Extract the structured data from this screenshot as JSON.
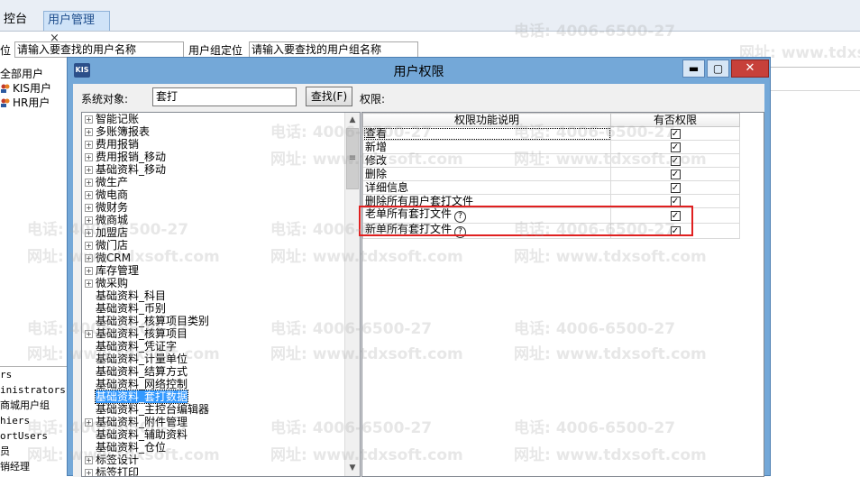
{
  "app": {
    "tabs": [
      {
        "label": "控台"
      },
      {
        "label": "用户管理",
        "close": "×"
      }
    ],
    "filter": {
      "user_label": "位",
      "user_placeholder": "请输入要查找的用户名称",
      "group_label": "用户组定位",
      "group_placeholder": "请输入要查找的用户组名称"
    },
    "tree": [
      "全部用户",
      "KIS用户",
      "HR用户"
    ],
    "bottom_list": [
      "rs",
      "inistrators",
      "商城用户组",
      "hiers",
      "ortUsers",
      "员",
      "销经理"
    ]
  },
  "dialog": {
    "logo": "KIS",
    "title": "用户权限",
    "min_glyph": "▬",
    "max_glyph": "▢",
    "close_glyph": "✕",
    "search_label": "系统对象:",
    "search_value": "套打",
    "search_button": "查找(F)",
    "permission_label": "权限:",
    "tree_items": [
      {
        "label": "智能记账",
        "expandable": true
      },
      {
        "label": "多账簿报表",
        "expandable": true
      },
      {
        "label": "费用报销",
        "expandable": true
      },
      {
        "label": "费用报销_移动",
        "expandable": true
      },
      {
        "label": "基础资料_移动",
        "expandable": true
      },
      {
        "label": "微生产",
        "expandable": true
      },
      {
        "label": "微电商",
        "expandable": true
      },
      {
        "label": "微财务",
        "expandable": true
      },
      {
        "label": "微商城",
        "expandable": true
      },
      {
        "label": "加盟店",
        "expandable": true
      },
      {
        "label": "微门店",
        "expandable": true
      },
      {
        "label": "微CRM",
        "expandable": true
      },
      {
        "label": "库存管理",
        "expandable": true
      },
      {
        "label": "微采购",
        "expandable": true
      },
      {
        "label": "基础资料_科目",
        "expandable": false
      },
      {
        "label": "基础资料_币别",
        "expandable": false
      },
      {
        "label": "基础资料_核算项目类别",
        "expandable": false
      },
      {
        "label": "基础资料_核算项目",
        "expandable": true
      },
      {
        "label": "基础资料_凭证字",
        "expandable": false
      },
      {
        "label": "基础资料_计量单位",
        "expandable": false
      },
      {
        "label": "基础资料_结算方式",
        "expandable": false
      },
      {
        "label": "基础资料_网络控制",
        "expandable": false
      },
      {
        "label": "基础资料_套打数据",
        "expandable": false,
        "selected": true
      },
      {
        "label": "基础资料_主控台编辑器",
        "expandable": false
      },
      {
        "label": "基础资料_附件管理",
        "expandable": true
      },
      {
        "label": "基础资料_辅助资料",
        "expandable": false
      },
      {
        "label": "基础资料_仓位",
        "expandable": false
      },
      {
        "label": "标签设计",
        "expandable": true
      },
      {
        "label": "标签打印",
        "expandable": true
      }
    ],
    "grid": {
      "headers": [
        "权限功能说明",
        "有否权限"
      ],
      "rows": [
        {
          "label": "查看",
          "checked": true,
          "help": false
        },
        {
          "label": "新增",
          "checked": true,
          "help": false
        },
        {
          "label": "修改",
          "checked": true,
          "help": false
        },
        {
          "label": "删除",
          "checked": true,
          "help": false
        },
        {
          "label": "详细信息",
          "checked": true,
          "help": false
        },
        {
          "label": "删除所有用户套打文件",
          "checked": true,
          "help": false
        },
        {
          "label": "老单所有套打文件",
          "checked": true,
          "help": true
        },
        {
          "label": "新单所有套打文件",
          "checked": true,
          "help": true
        }
      ]
    }
  },
  "watermark": {
    "phone": "电话: 4006-6500-27",
    "site": "网址: www.tdxsoft.com"
  },
  "colors": {
    "titlebar": "#74a8d8",
    "close": "#c7403a",
    "highlight": "#e02020",
    "selection": "#3399ff"
  }
}
